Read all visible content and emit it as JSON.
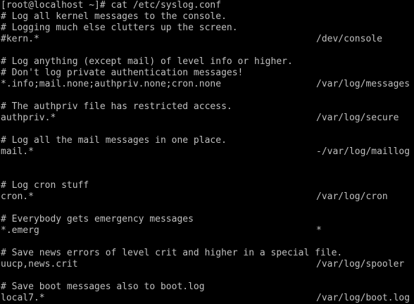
{
  "terminal": {
    "prompt": "[root@localhost ~]# cat /etc/syslog.conf",
    "lines": [
      {
        "left": "# Log all kernel messages to the console."
      },
      {
        "left": "# Logging much else clutters up the screen."
      },
      {
        "left": "#kern.*",
        "right": "/dev/console"
      },
      {
        "left": ""
      },
      {
        "left": "# Log anything (except mail) of level info or higher."
      },
      {
        "left": "# Don't log private authentication messages!"
      },
      {
        "left": "*.info;mail.none;authpriv.none;cron.none",
        "right": "/var/log/messages"
      },
      {
        "left": ""
      },
      {
        "left": "# The authpriv file has restricted access."
      },
      {
        "left": "authpriv.*",
        "right": "/var/log/secure"
      },
      {
        "left": ""
      },
      {
        "left": "# Log all the mail messages in one place."
      },
      {
        "left": "mail.*",
        "right": "-/var/log/maillog"
      },
      {
        "left": ""
      },
      {
        "left": ""
      },
      {
        "left": "# Log cron stuff"
      },
      {
        "left": "cron.*",
        "right": "/var/log/cron"
      },
      {
        "left": ""
      },
      {
        "left": "# Everybody gets emergency messages"
      },
      {
        "left": "*.emerg",
        "right": "*"
      },
      {
        "left": ""
      },
      {
        "left": "# Save news errors of level crit and higher in a special file."
      },
      {
        "left": "uucp,news.crit",
        "right": "/var/log/spooler"
      },
      {
        "left": ""
      },
      {
        "left": "# Save boot messages also to boot.log"
      },
      {
        "left": "local7.*",
        "right": "/var/log/boot.log"
      }
    ]
  },
  "colors": {
    "background": "#000000",
    "text": "#c0c0c0"
  }
}
